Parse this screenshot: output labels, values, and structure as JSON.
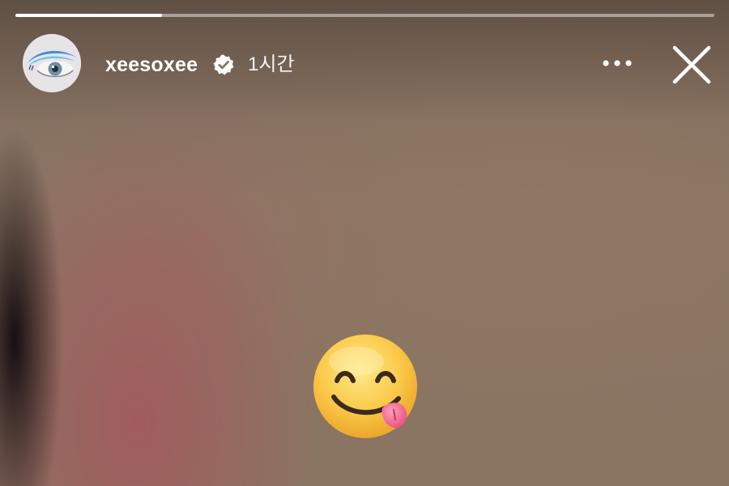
{
  "story": {
    "progress": 0.21,
    "author": {
      "username": "xeesoxee",
      "verified": true,
      "avatar_icon": "eye-makeup-avatar"
    },
    "time_ago": "1시간",
    "actions": {
      "more_icon": "more-horizontal-icon",
      "close_icon": "close-icon"
    },
    "sticker": "face-savoring-food-emoji"
  },
  "colors": {
    "progress_fill": "#ffffff",
    "progress_track": "rgba(255,255,255,0.45)",
    "text": "#ffffff"
  }
}
